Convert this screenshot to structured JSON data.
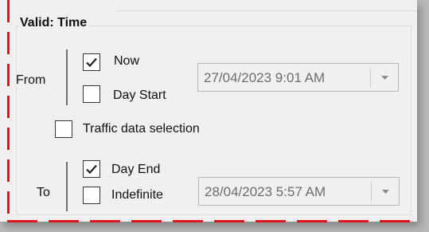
{
  "group": {
    "title": "Valid: Time"
  },
  "from": {
    "label": "From",
    "options": [
      {
        "label": "Now",
        "checked": true
      },
      {
        "label": "Day Start",
        "checked": false
      }
    ],
    "datetime": {
      "value": "27/04/2023 9:01 AM",
      "enabled": false
    }
  },
  "traffic": {
    "label": "Traffic data selection",
    "checked": false
  },
  "to": {
    "label": "To",
    "options": [
      {
        "label": "Day End",
        "checked": true
      },
      {
        "label": "Indefinite",
        "checked": false
      }
    ],
    "datetime": {
      "value": "28/04/2023 5:57 AM",
      "enabled": false
    }
  },
  "icons": {
    "check": "checkmark-icon",
    "dropdown": "chevron-down-icon"
  },
  "colors": {
    "annotation_dash": "#e0141e",
    "panel_background": "#f0f0f0",
    "disabled_text": "#6d6d6d"
  }
}
